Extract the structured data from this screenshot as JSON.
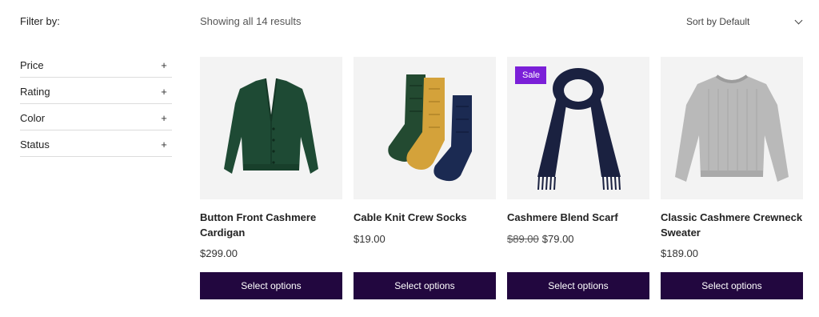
{
  "sidebar": {
    "title": "Filter by:",
    "filters": [
      {
        "label": "Price",
        "toggle": "+"
      },
      {
        "label": "Rating",
        "toggle": "+"
      },
      {
        "label": "Color",
        "toggle": "+"
      },
      {
        "label": "Status",
        "toggle": "+"
      }
    ]
  },
  "toolbar": {
    "result_count": "Showing all 14 results",
    "sort_label": "Sort by",
    "sort_value": "Default"
  },
  "products": [
    {
      "title": "Button Front Cashmere Cardigan",
      "price": "$299.00",
      "old_price": "",
      "badge": "",
      "button": "Select options",
      "icon": "green-cardigan-image"
    },
    {
      "title": "Cable Knit Crew Socks",
      "price": "$19.00",
      "old_price": "",
      "badge": "",
      "button": "Select options",
      "icon": "knit-socks-image"
    },
    {
      "title": "Cashmere Blend Scarf",
      "price": "$79.00",
      "old_price": "$89.00",
      "badge": "Sale",
      "button": "Select options",
      "icon": "navy-scarf-image"
    },
    {
      "title": "Classic Cashmere Crewneck Sweater",
      "price": "$189.00",
      "old_price": "",
      "badge": "",
      "button": "Select options",
      "icon": "grey-sweater-image"
    }
  ],
  "colors": {
    "button_bg": "#22073f",
    "badge_bg": "#7b1fd8",
    "cardigan": "#1e4a34",
    "sock_green": "#234a31",
    "sock_mustard": "#d4a23a",
    "sock_navy": "#1b2a52",
    "scarf": "#1a2140",
    "sweater": "#b9b9b9"
  }
}
